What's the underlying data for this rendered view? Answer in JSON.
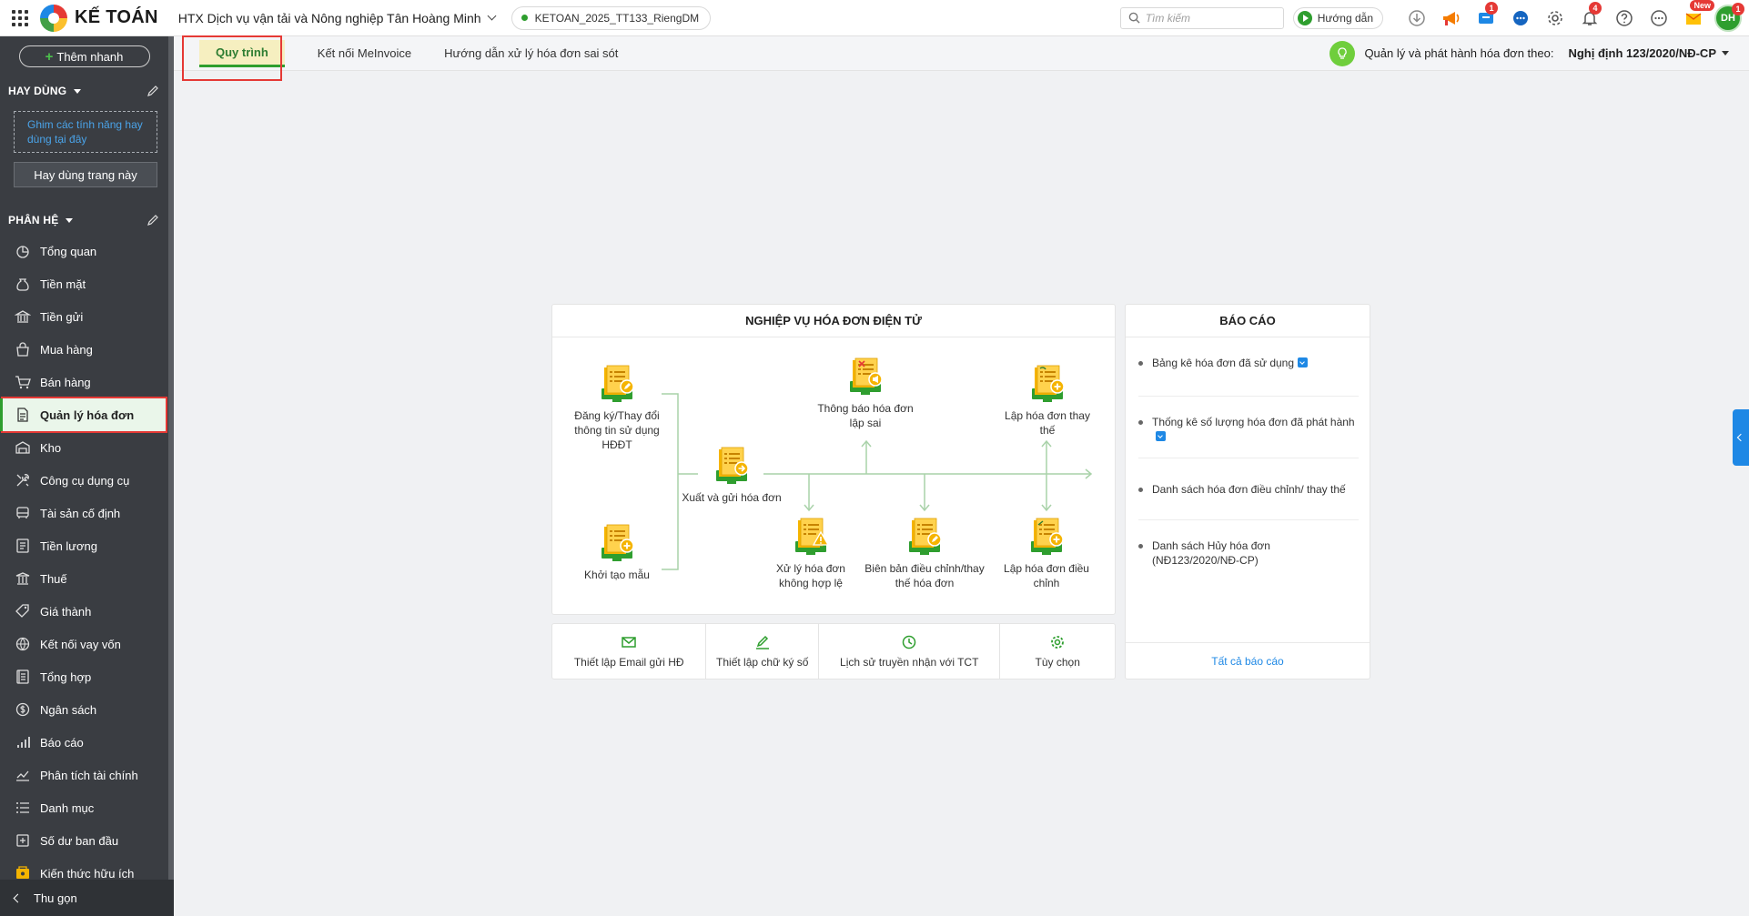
{
  "header": {
    "logo_text": "KẾ TOÁN",
    "company_name": "HTX Dịch vụ vận tải và Nông nghiệp Tân Hoàng Minh",
    "database": "KETOAN_2025_TT133_RiengDM",
    "search_placeholder": "Tìm kiếm",
    "guide_label": "Hướng dẫn",
    "cart_badge": "1",
    "bell_badge": "4",
    "new_badge": "New",
    "avatar_initials": "DH",
    "avatar_badge": "1"
  },
  "sidebar": {
    "quick_add": "Thêm nhanh",
    "favorites_title": "HAY DÙNG",
    "pin_hint": "Ghim các tính năng hay dùng tại đây",
    "favorite_page": "Hay dùng trang này",
    "modules_title": "PHÂN HỆ",
    "items": [
      {
        "label": "Tổng quan",
        "icon": "overview-icon"
      },
      {
        "label": "Tiền mặt",
        "icon": "cash-icon"
      },
      {
        "label": "Tiền gửi",
        "icon": "bank-icon"
      },
      {
        "label": "Mua hàng",
        "icon": "purchase-icon"
      },
      {
        "label": "Bán hàng",
        "icon": "cart-icon"
      },
      {
        "label": "Quản lý hóa đơn",
        "icon": "invoice-icon"
      },
      {
        "label": "Kho",
        "icon": "warehouse-icon"
      },
      {
        "label": "Công cụ dụng cụ",
        "icon": "tools-icon"
      },
      {
        "label": "Tài sản cố định",
        "icon": "asset-icon"
      },
      {
        "label": "Tiền lương",
        "icon": "salary-icon"
      },
      {
        "label": "Thuế",
        "icon": "tax-icon"
      },
      {
        "label": "Giá thành",
        "icon": "price-tag-icon"
      },
      {
        "label": "Kết nối vay vốn",
        "icon": "loan-icon"
      },
      {
        "label": "Tổng hợp",
        "icon": "ledger-icon"
      },
      {
        "label": "Ngân sách",
        "icon": "budget-icon"
      },
      {
        "label": "Báo cáo",
        "icon": "report-icon"
      },
      {
        "label": "Phân tích tài chính",
        "icon": "analysis-icon"
      },
      {
        "label": "Danh mục",
        "icon": "list-icon"
      },
      {
        "label": "Số dư ban đầu",
        "icon": "balance-icon"
      },
      {
        "label": "Kiến thức hữu ích",
        "icon": "knowledge-icon"
      }
    ],
    "active_item": "Quản lý hóa đơn",
    "collapse_label": "Thu gọn"
  },
  "tabs": {
    "items": [
      "Quy trình",
      "Kết nối MeInvoice",
      "Hướng dẫn xử lý hóa đơn sai sót"
    ],
    "active": "Quy trình"
  },
  "decree": {
    "label": "Quản lý và phát hành hóa đơn theo:",
    "value": "Nghị định 123/2020/NĐ-CP"
  },
  "workflow": {
    "title": "NGHIỆP VỤ HÓA ĐƠN ĐIỆN TỬ",
    "register": "Đăng ký/Thay đổi thông tin sử dụng HĐĐT",
    "create_template": "Khởi tạo mẫu",
    "issue_send": "Xuất và gửi hóa đơn",
    "notify_error": "Thông báo hóa đơn lập sai",
    "create_replace": "Lập hóa đơn thay thế",
    "handle_invalid": "Xử lý hóa đơn không hợp lệ",
    "adjust_minutes": "Biên bản điều chỉnh/thay thế hóa đơn",
    "create_adjust": "Lập hóa đơn điều chỉnh"
  },
  "tools": {
    "email": "Thiết lập Email gửi HĐ",
    "signature": "Thiết lập chữ ký số",
    "history": "Lịch sử truyền nhận với TCT",
    "options": "Tùy chọn"
  },
  "reports": {
    "title": "BÁO CÁO",
    "items": [
      "Bảng kê hóa đơn đã sử dụng",
      "Thống kê số lượng hóa đơn đã phát hành",
      "Danh sách hóa đơn điều chỉnh/ thay thế",
      "Danh sách Hủy hóa đơn (NĐ123/2020/NĐ-CP)"
    ],
    "all_reports": "Tất cả báo cáo"
  },
  "colors": {
    "accent_green": "#2e9e2e",
    "sidebar_bg": "#3a3d42",
    "highlight_red": "#e53935",
    "link_blue": "#1e88e5"
  }
}
